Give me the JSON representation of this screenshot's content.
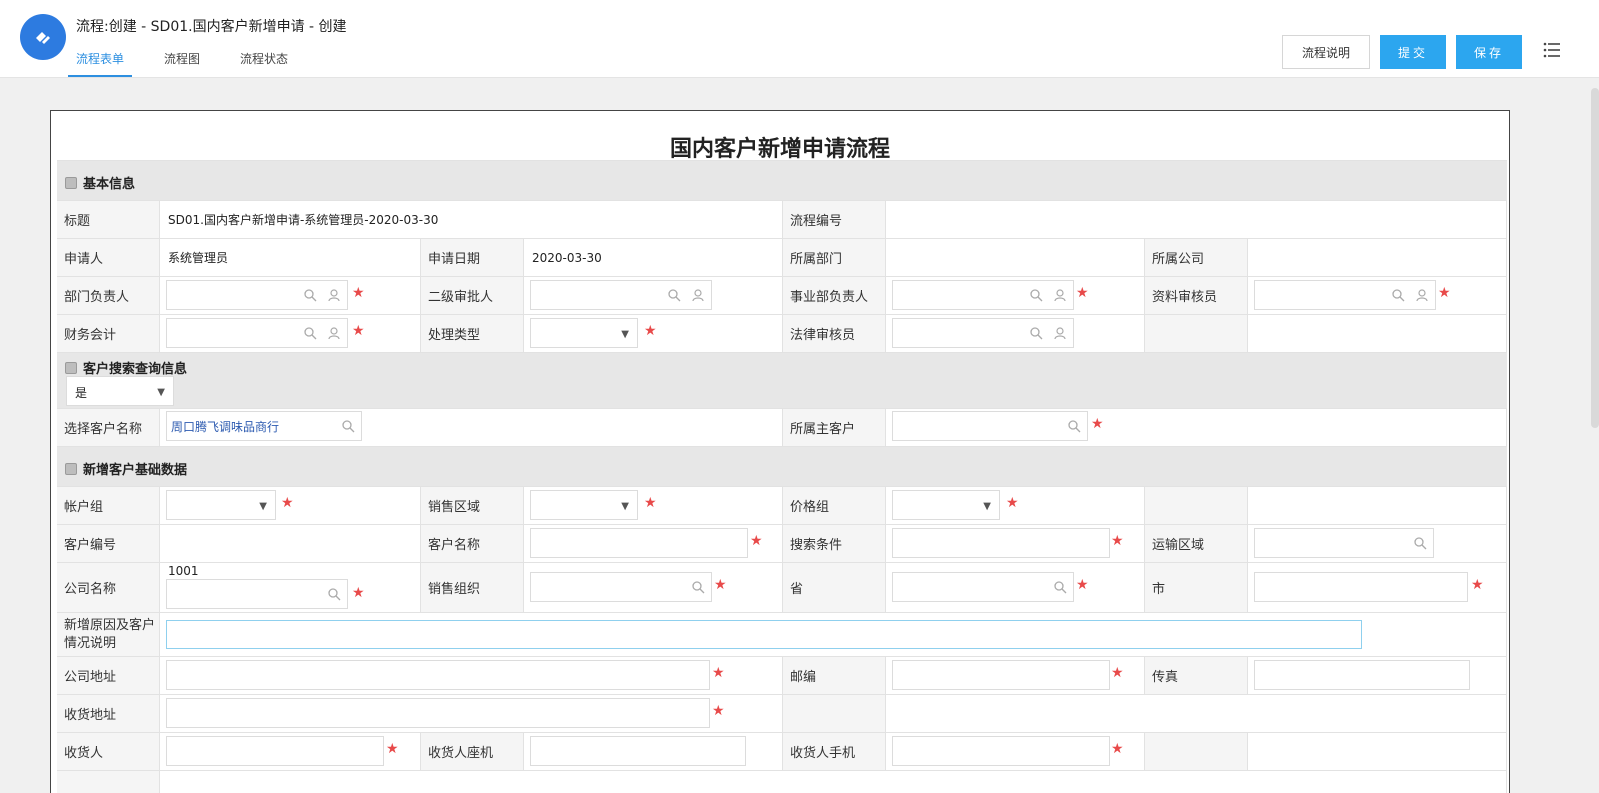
{
  "header": {
    "title": "流程:创建 - SD01.国内客户新增申请 - 创建",
    "tabs": [
      "流程表单",
      "流程图",
      "流程状态"
    ],
    "buttons": {
      "explain": "流程说明",
      "submit": "提交",
      "save": "保存"
    }
  },
  "form": {
    "title": "国内客户新增申请流程",
    "sections": {
      "basic": "基本信息",
      "search": "客户搜索查询信息",
      "newdata": "新增客户基础数据"
    },
    "basic": {
      "title_label": "标题",
      "title_value": "SD01.国内客户新增申请-系统管理员-2020-03-30",
      "flow_no_label": "流程编号",
      "applicant_label": "申请人",
      "applicant_value": "系统管理员",
      "apply_date_label": "申请日期",
      "apply_date_value": "2020-03-30",
      "dept_label": "所属部门",
      "company_label": "所属公司",
      "dept_head_label": "部门负责人",
      "second_approver_label": "二级审批人",
      "bu_head_label": "事业部负责人",
      "doc_reviewer_label": "资料审核员",
      "accountant_label": "财务会计",
      "process_type_label": "处理类型",
      "legal_reviewer_label": "法律审核员"
    },
    "search": {
      "yes_value": "是",
      "select_customer_label": "选择客户名称",
      "select_customer_value": "周口腾飞调味品商行",
      "main_customer_label": "所属主客户"
    },
    "newdata": {
      "account_group_label": "帐户组",
      "sales_region_label": "销售区域",
      "price_group_label": "价格组",
      "customer_no_label": "客户编号",
      "customer_name_label": "客户名称",
      "search_cond_label": "搜索条件",
      "transport_region_label": "运输区域",
      "company_name_label": "公司名称",
      "company_name_value": "1001",
      "sales_org_label": "销售组织",
      "province_label": "省",
      "city_label": "市",
      "reason_label": "新增原因及客户情况说明",
      "company_address_label": "公司地址",
      "postcode_label": "邮编",
      "fax_label": "传真",
      "ship_address_label": "收货地址",
      "receiver_label": "收货人",
      "receiver_phone_label": "收货人座机",
      "receiver_mobile_label": "收货人手机"
    }
  },
  "colors": {
    "accent": "#2ca6ef",
    "required": "#e84a4a",
    "link": "#2d5bb0"
  }
}
